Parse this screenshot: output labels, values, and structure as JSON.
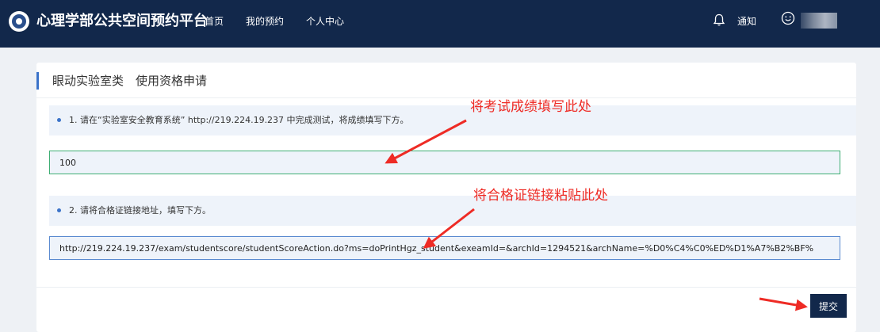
{
  "app": {
    "brand_title": "心理学部公共空间预约平台",
    "nav": [
      {
        "label": "首页"
      },
      {
        "label": "我的预约"
      },
      {
        "label": "个人中心"
      }
    ],
    "notice_label": "通知"
  },
  "page": {
    "title": "眼动实验室类　使用资格申请"
  },
  "form": {
    "step1_text": "1. 请在“实验室安全教育系统” http://219.224.19.237 中完成测试，将成绩填写下方。",
    "score_value": "100",
    "step2_text": "2. 请将合格证链接地址，填写下方。",
    "link_value": "http://219.224.19.237/exam/studentscore/studentScoreAction.do?ms=doPrintHgz_student&exeamId=&archId=1294521&archName=%D0%C4%C0%ED%D1%A7%B2%BF%",
    "submit_label": "提交"
  },
  "annotations": {
    "score_hint": "将考试成绩填写此处",
    "link_hint": "将合格证链接粘贴此处",
    "color": "#ee2b25"
  },
  "icons": [
    "logo-emblem-icon",
    "bell-icon",
    "smile-icon"
  ],
  "colors": {
    "topbar": "#12284b",
    "accent": "#3b73c9",
    "score_border": "#3fae74",
    "link_border": "#5b8bd0"
  }
}
